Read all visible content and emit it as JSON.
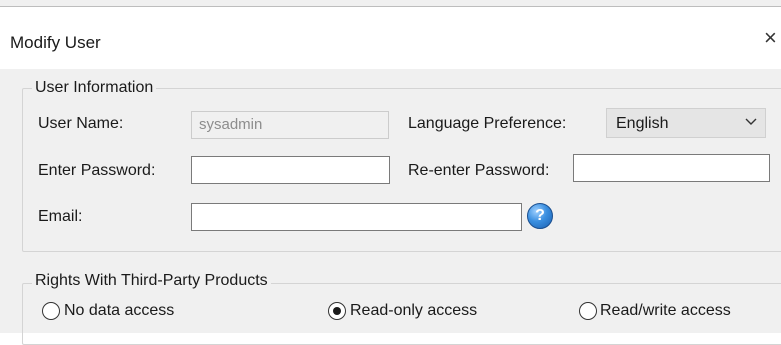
{
  "window": {
    "title": "Modify User",
    "close_glyph": "×"
  },
  "user_info": {
    "legend": "User Information",
    "user_name_label": "User Name:",
    "user_name_value": "sysadmin",
    "language_label": "Language Preference:",
    "language_value": "English",
    "password_label": "Enter Password:",
    "password_value": "",
    "reenter_label": "Re-enter Password:",
    "reenter_value": "",
    "email_label": "Email:",
    "email_value": "",
    "help_glyph": "?"
  },
  "rights": {
    "legend": "Rights With Third-Party Products",
    "options": [
      {
        "label": "No data access",
        "checked": false
      },
      {
        "label": "Read-only access",
        "checked": true
      },
      {
        "label": "Read/write access",
        "checked": false
      }
    ]
  },
  "colors": {
    "dialog_bg": "#f0f0f0",
    "titlebar_bg": "#ffffff",
    "help_icon": "#3a8fe0"
  },
  "icons": {
    "close": "close-icon",
    "help": "help-icon",
    "dropdown": "chevron-down-icon"
  }
}
